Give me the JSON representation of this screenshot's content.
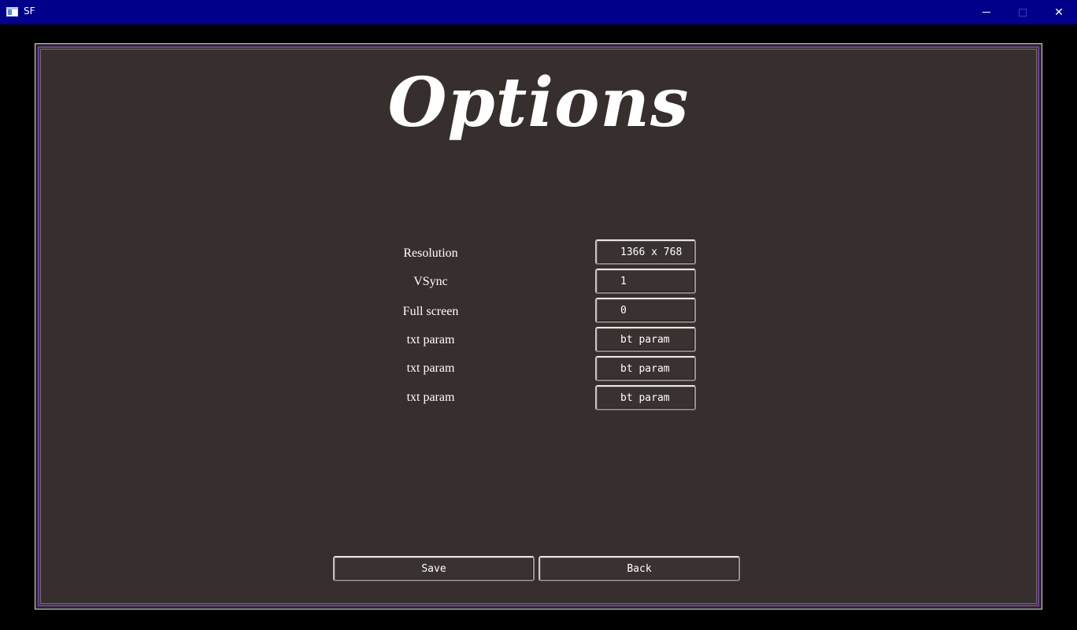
{
  "window": {
    "title": "SF",
    "close_glyph": "✕"
  },
  "page": {
    "title": "Options"
  },
  "settings": [
    {
      "label": "Resolution",
      "value": "1366 x 768"
    },
    {
      "label": "VSync",
      "value": "1"
    },
    {
      "label": "Full screen",
      "value": "0"
    },
    {
      "label": "txt param",
      "value": "bt param"
    },
    {
      "label": "txt param",
      "value": "bt param"
    },
    {
      "label": "txt param",
      "value": "bt param"
    }
  ],
  "actions": {
    "save_label": "Save",
    "back_label": "Back"
  },
  "colors": {
    "titlebar": "#00008b",
    "panel_background": "#372f2d",
    "panel_accent": "#6a3ea3",
    "text": "#ffffff"
  }
}
